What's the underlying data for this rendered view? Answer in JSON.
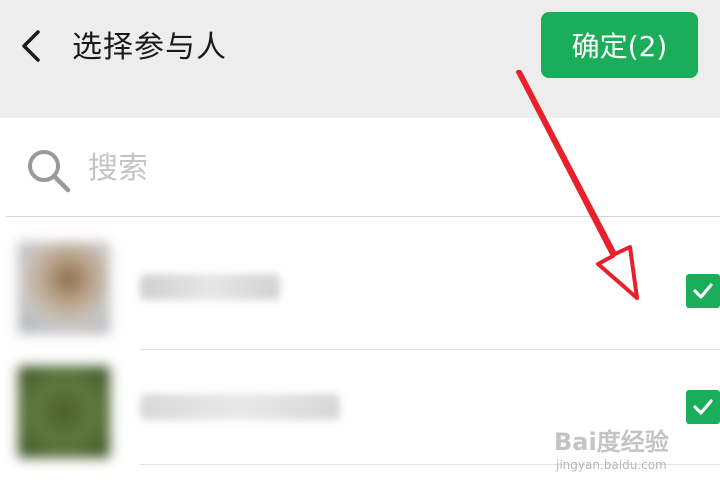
{
  "header": {
    "title": "选择参与人",
    "confirm_label": "确定(2)"
  },
  "search": {
    "placeholder": "搜索",
    "value": ""
  },
  "contacts": [
    {
      "name": "",
      "selected": true
    },
    {
      "name": "",
      "selected": true
    }
  ],
  "watermark": {
    "logo_text": "Bai度经验",
    "url": "jingyan.baidu.com"
  },
  "colors": {
    "accent": "#1aad5a",
    "header_bg": "#ededed",
    "annotation": "#e8202a"
  },
  "icons": {
    "back": "chevron-left-icon",
    "search": "search-icon",
    "check": "checkmark-icon"
  }
}
